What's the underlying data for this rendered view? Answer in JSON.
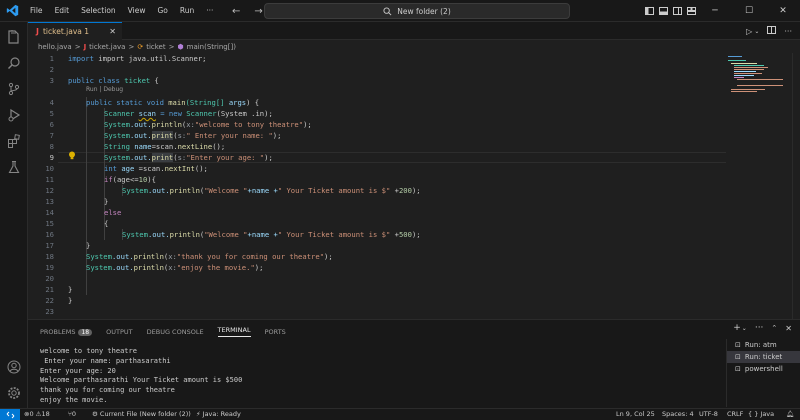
{
  "menu": [
    "File",
    "Edit",
    "Selection",
    "View",
    "Go",
    "Run",
    "···"
  ],
  "command_center": "New folder (2)",
  "tab": {
    "icon": "J",
    "label": "ticket.java 1"
  },
  "breadcrumb": {
    "file1": "hello.java",
    "file2": "ticket.java",
    "cls": "ticket",
    "method": "main(String[])",
    "sep": ">"
  },
  "codelens": "Run | Debug",
  "lines": {
    "l1": "import java.util.Scanner;",
    "l3a": "public class",
    "l3b": "ticket",
    "l3c": " {",
    "l4a": "public static void",
    "l4b": "main",
    "l4c": "(String[]",
    "l4d": "args",
    "l4e": ") {",
    "l5a": "Scanner",
    "l5b": "scan",
    "l5c": " = new",
    "l5d": "Scanner",
    "l5e": "(System .in);",
    "l6a": "System",
    "l6b": ".out.",
    "l6c": "println",
    "l6d": "(",
    "l6e": "x:",
    "l6f": "\"welcome to tony theatre\"",
    "l6g": ");",
    "l7a": "System",
    "l7b": ".out.",
    "l7c": "print",
    "l7d": "(",
    "l7e": "s:",
    "l7f": "\" Enter your name: \"",
    "l7g": ");",
    "l8a": "String",
    "l8b": "name",
    "l8c": "=scan.",
    "l8d": "nextLine",
    "l8e": "();",
    "l9a": "System",
    "l9b": ".out.",
    "l9c": "print",
    "l9d": "(",
    "l9e": "s:",
    "l9f": "\"Enter your age: \"",
    "l9g": ");",
    "l10a": "int",
    "l10b": "age",
    "l10c": " =scan.",
    "l10d": "nextInt",
    "l10e": "();",
    "l11a": "if",
    "l11b": "(age<=",
    "l11c": "10",
    "l11d": "){",
    "l12a": "System",
    "l12b": ".out.",
    "l12c": "println",
    "l12d": "(",
    "l12e": "\"Welcome \"",
    "l12f": "+name +",
    "l12g": "\" Your Ticket amount is $\"",
    "l12h": " +",
    "l12i": "200",
    "l12j": ");",
    "l13": "}",
    "l14": "else",
    "l15": "{",
    "l16a": "System",
    "l16b": ".out.",
    "l16c": "println",
    "l16d": "(",
    "l16e": "\"Welcome \"",
    "l16f": "+name +",
    "l16g": "\" Your Ticket amount is $\"",
    "l16h": " +",
    "l16i": "500",
    "l16j": ");",
    "l17": "}",
    "l18a": "System",
    "l18b": ".out.",
    "l18c": "println",
    "l18d": "(",
    "l18e": "x:",
    "l18f": "\"thank you for coming our theatre\"",
    "l18g": ");",
    "l19a": "System",
    "l19b": ".out.",
    "l19c": "println",
    "l19d": "(",
    "l19e": "x:",
    "l19f": "\"enjoy the movie.\"",
    "l19g": ");",
    "l21": "}",
    "l22": "}"
  },
  "line_numbers": [
    "1",
    "2",
    "3",
    "4",
    "5",
    "6",
    "7",
    "8",
    "9",
    "10",
    "11",
    "12",
    "13",
    "14",
    "15",
    "16",
    "17",
    "18",
    "19",
    "20",
    "21",
    "22",
    "23"
  ],
  "panel": {
    "tabs": {
      "problems": "PROBLEMS",
      "problems_count": "18",
      "output": "OUTPUT",
      "debug": "DEBUG CONSOLE",
      "terminal": "TERMINAL",
      "ports": "PORTS"
    },
    "terminal_output": "welcome to tony theatre\n Enter your name: parthasarathi\nEnter your age: 20\nWelcome parthasarathi Your Ticket amount is $500\nthank you for coming our theatre\nenjoy the movie.",
    "terminals": [
      "Run: atm",
      "Run: ticket",
      "powershell"
    ]
  },
  "status": {
    "errors": "0",
    "warnings": "18",
    "ports": "0",
    "run": "Current File (New folder (2))",
    "java": "Java: Ready",
    "position": "Ln 9, Col 25",
    "spaces": "Spaces: 4",
    "encoding": "UTF-8",
    "eol": "CRLF",
    "language": "{ } Java"
  },
  "colors": {
    "accent": "#0078d4",
    "error": "#f14c4c",
    "warning_tab": "#e2c08d"
  }
}
